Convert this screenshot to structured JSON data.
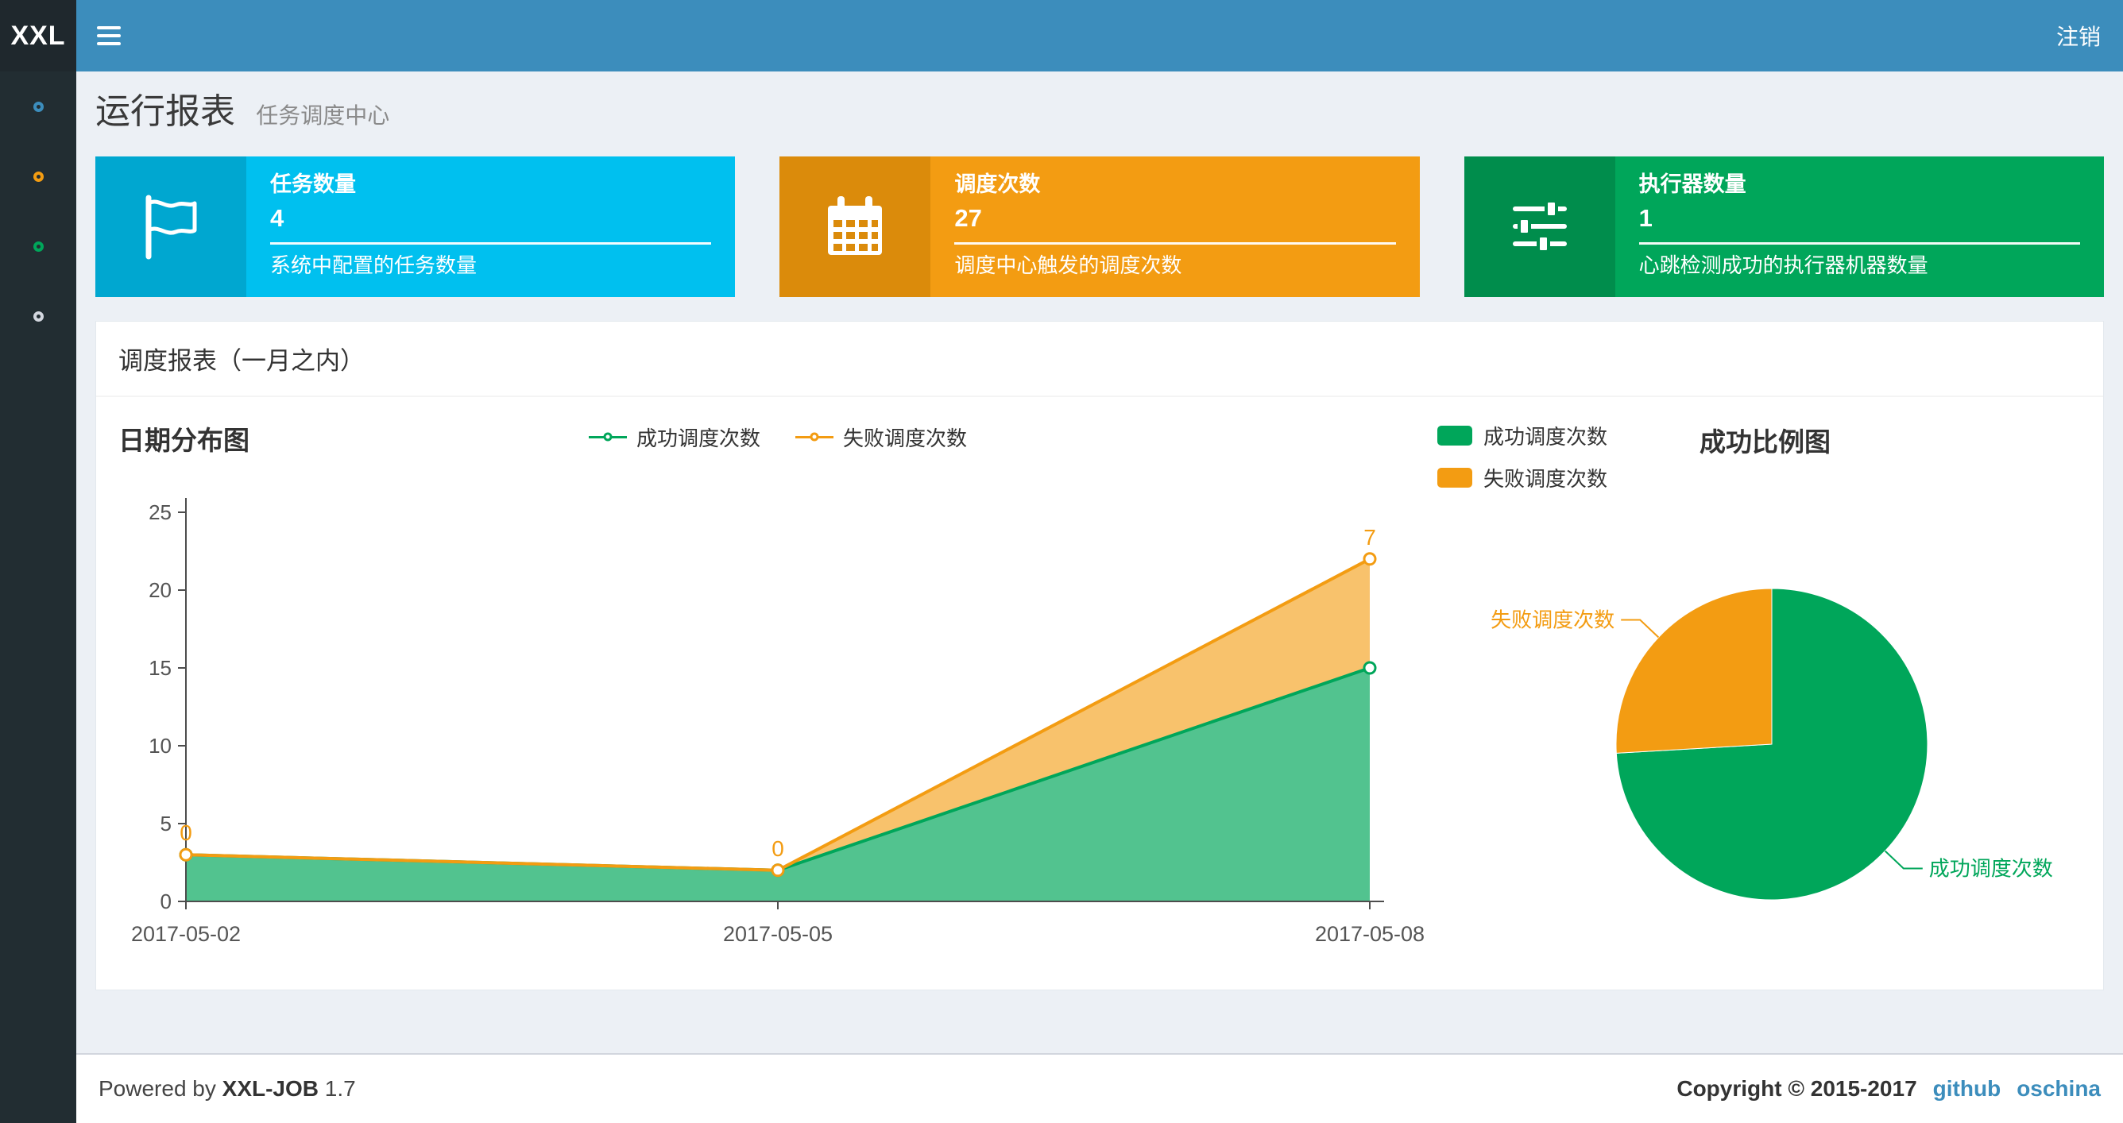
{
  "brand_color": "#3c8dbc",
  "header": {
    "logo": "XXL",
    "logout": "注销"
  },
  "sidebar": {
    "items": [
      {
        "name": "menu-1",
        "color": "#3c8dbc"
      },
      {
        "name": "menu-2",
        "color": "#f39c12"
      },
      {
        "name": "menu-3",
        "color": "#00a65a"
      },
      {
        "name": "menu-4",
        "color": "#d2d6de"
      }
    ]
  },
  "page": {
    "title": "运行报表",
    "subtitle": "任务调度中心"
  },
  "info_boxes": [
    {
      "title": "任务数量",
      "value": "4",
      "desc": "系统中配置的任务数量",
      "color": "#00c0ef",
      "icon_color": "#00a7d0",
      "icon": "flag-icon"
    },
    {
      "title": "调度次数",
      "value": "27",
      "desc": "调度中心触发的调度次数",
      "color": "#f39c12",
      "icon_color": "#db8b0b",
      "icon": "calendar-icon"
    },
    {
      "title": "执行器数量",
      "value": "1",
      "desc": "心跳检测成功的执行器机器数量",
      "color": "#00a65a",
      "icon_color": "#008d4c",
      "icon": "sliders-icon"
    }
  ],
  "panel": {
    "title": "调度报表（一月之内）"
  },
  "chart_data": [
    {
      "type": "area",
      "title": "日期分布图",
      "stacked": true,
      "categories": [
        "2017-05-02",
        "2017-05-05",
        "2017-05-08"
      ],
      "series": [
        {
          "name": "成功调度次数",
          "values": [
            3,
            2,
            15
          ],
          "color": "#00a65a"
        },
        {
          "name": "失败调度次数",
          "values": [
            0,
            0,
            7
          ],
          "color": "#f39c12",
          "labels": [
            "0",
            "0",
            "7"
          ]
        }
      ],
      "ylim": [
        0,
        25
      ],
      "yticks": [
        0,
        5,
        10,
        15,
        20,
        25
      ],
      "legend_position": "top"
    },
    {
      "type": "pie",
      "title": "成功比例图",
      "slices": [
        {
          "name": "成功调度次数",
          "value": 20,
          "color": "#00a65a"
        },
        {
          "name": "失败调度次数",
          "value": 7,
          "color": "#f39c12"
        }
      ],
      "legend_position": "top-left"
    }
  ],
  "footer": {
    "powered_prefix": "Powered by",
    "product": "XXL-JOB",
    "version": "1.7",
    "copyright": "Copyright © 2015-2017",
    "links": [
      "github",
      "oschina"
    ]
  }
}
